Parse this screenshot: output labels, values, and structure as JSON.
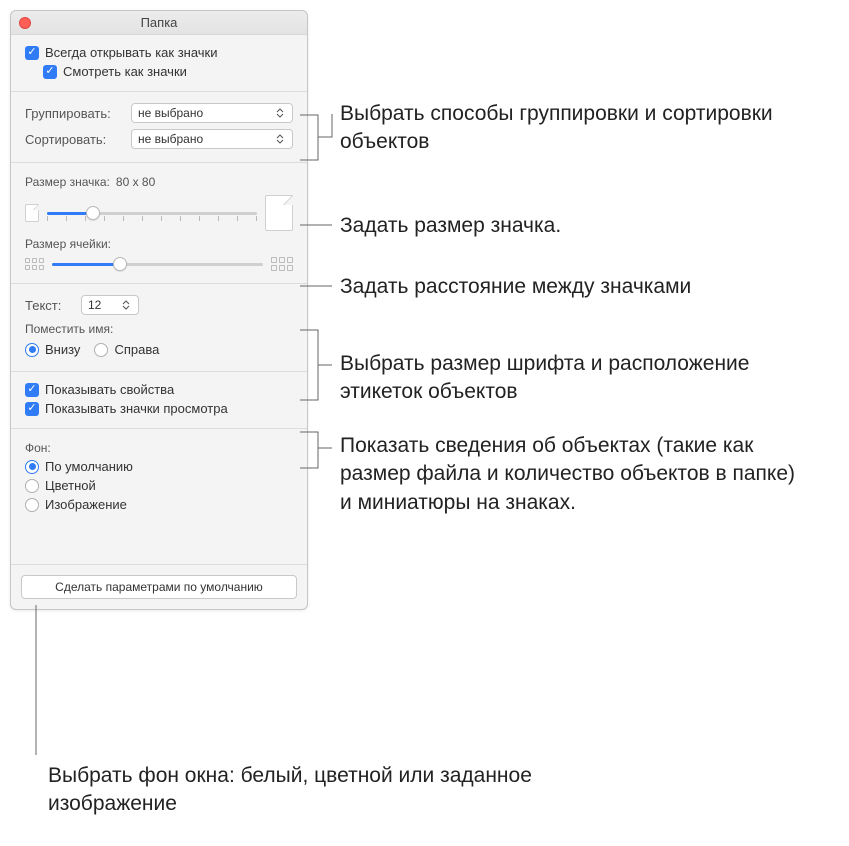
{
  "window": {
    "title": "Папка"
  },
  "checkboxes": {
    "always_open": "Всегда открывать как значки",
    "view_as_icons": "Смотреть как значки",
    "show_props": "Показывать свойства",
    "show_preview": "Показывать значки просмотра"
  },
  "labels": {
    "group": "Группировать:",
    "sort": "Сортировать:",
    "icon_size": "Размер значка:",
    "icon_size_value": "80 x 80",
    "cell_size": "Размер ячейки:",
    "text": "Текст:",
    "text_value": "12",
    "label_pos": "Поместить имя:",
    "bottom": "Внизу",
    "right": "Справа",
    "background": "Фон:",
    "bg_default": "По умолчанию",
    "bg_color": "Цветной",
    "bg_image": "Изображение",
    "not_selected": "не выбрано"
  },
  "buttons": {
    "make_default": "Сделать параметрами по умолчанию"
  },
  "callouts": {
    "c1": "Выбрать способы группировки и сортировки объектов",
    "c2": "Задать размер значка.",
    "c3": "Задать расстояние между значками",
    "c4": "Выбрать размер шрифта и расположение этикеток объектов",
    "c5": "Показать сведения об объектах (такие как размер файла и количество объектов в папке) и миниатюры на знаках.",
    "c6": "Выбрать фон окна: белый, цветной или заданное изображение"
  }
}
